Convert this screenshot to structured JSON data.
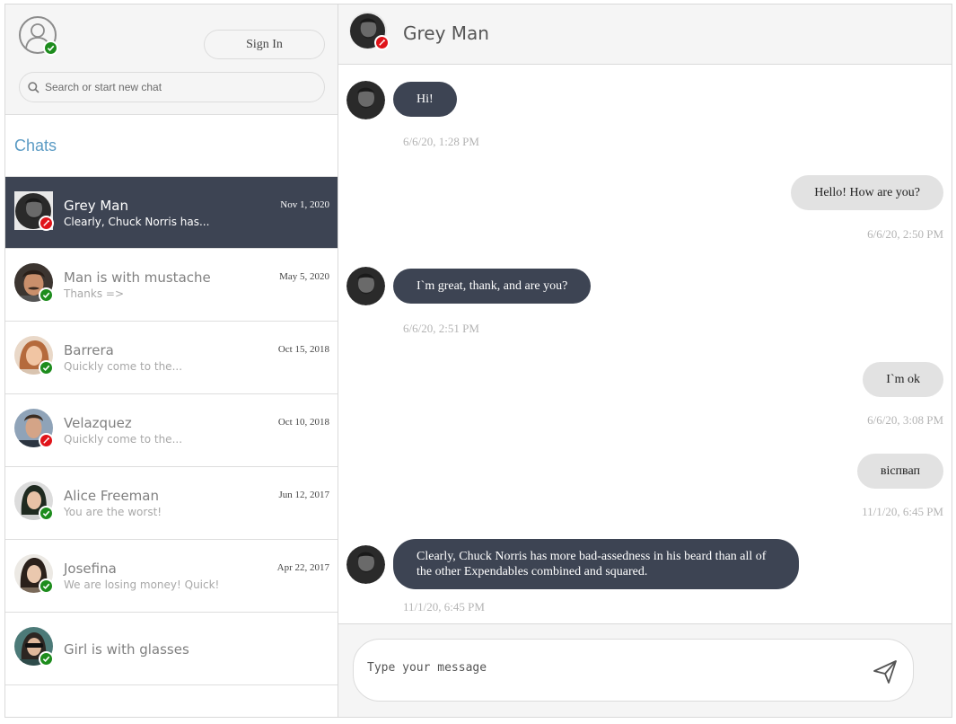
{
  "sidebar": {
    "sign_in_label": "Sign In",
    "search_placeholder": "Search or start new chat",
    "chats_heading": "Chats",
    "chats": [
      {
        "name": "Grey Man",
        "preview": "Clearly, Chuck Norris has...",
        "date": "Nov 1, 2020",
        "status": "offline",
        "active": true,
        "avatar_icon": "grey-man-avatar"
      },
      {
        "name": "Man is with mustache",
        "preview": "Thanks =>",
        "date": "May 5, 2020",
        "status": "online",
        "active": false,
        "avatar_icon": "mustache-man-avatar"
      },
      {
        "name": "Barrera",
        "preview": "Quickly come to the...",
        "date": "Oct 15, 2018",
        "status": "online",
        "active": false,
        "avatar_icon": "barrera-avatar"
      },
      {
        "name": "Velazquez",
        "preview": "Quickly come to the...",
        "date": "Oct 10, 2018",
        "status": "offline",
        "active": false,
        "avatar_icon": "velazquez-avatar"
      },
      {
        "name": "Alice Freeman",
        "preview": "You are the worst!",
        "date": "Jun 12, 2017",
        "status": "online",
        "active": false,
        "avatar_icon": "alice-avatar"
      },
      {
        "name": "Josefina",
        "preview": "We are losing money! Quick!",
        "date": "Apr 22, 2017",
        "status": "online",
        "active": false,
        "avatar_icon": "josefina-avatar"
      },
      {
        "name": "Girl is with glasses",
        "preview": "",
        "date": "",
        "status": "online",
        "active": false,
        "avatar_icon": "glasses-girl-avatar"
      }
    ]
  },
  "conversation": {
    "contact_name": "Grey Man",
    "contact_status": "offline",
    "messages": [
      {
        "direction": "in",
        "text": "Hi!",
        "time": "6/6/20, 1:28 PM"
      },
      {
        "direction": "out",
        "text": "Hello! How are you?",
        "time": "6/6/20, 2:50 PM"
      },
      {
        "direction": "in",
        "text": "I`m great, thank, and are you?",
        "time": "6/6/20, 2:51 PM"
      },
      {
        "direction": "out",
        "text": "I`m ok",
        "time": "6/6/20, 3:08 PM"
      },
      {
        "direction": "out",
        "text": "віспвап",
        "time": "11/1/20, 6:45 PM"
      },
      {
        "direction": "in",
        "text": "Clearly, Chuck Norris has more bad-assedness in his beard than all of the other Expendables combined and squared.",
        "time": "11/1/20, 6:45 PM"
      }
    ],
    "composer_placeholder": "Type your message"
  },
  "colors": {
    "accent_dark": "#3d4453",
    "online": "#1d8c1d",
    "offline": "#e0141a",
    "chats_heading": "#5b9bc4"
  },
  "icons": {
    "user": "user-icon",
    "search": "search-icon",
    "send": "send-icon",
    "check": "check-icon",
    "offline": "offline-icon"
  }
}
